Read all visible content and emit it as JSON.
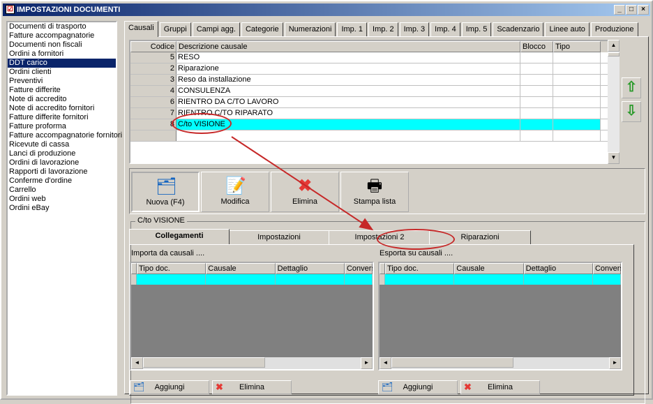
{
  "window": {
    "title": "IMPOSTAZIONI DOCUMENTI",
    "min_label": "_",
    "max_label": "□",
    "close_label": "×"
  },
  "doc_types": [
    "Documenti di trasporto",
    "Fatture accompagnatorie",
    "Documenti non fiscali",
    "Ordini a fornitori",
    "DDT carico",
    "Ordini clienti",
    "Preventivi",
    "Fatture differite",
    "Note di accredito",
    "Note di accredito fornitori",
    "Fatture differite fornitori",
    "Fatture proforma",
    "Fatture accompagnatorie fornitori",
    "Ricevute di cassa",
    "Lanci di produzione",
    "Ordini di lavorazione",
    "Rapporti di lavorazione",
    "Conferme d'ordine",
    "Carrello",
    "Ordini web",
    "Ordini eBay"
  ],
  "selected_doc_type": "DDT carico",
  "tabs": [
    "Causali",
    "Gruppi",
    "Campi agg.",
    "Categorie",
    "Numerazioni",
    "Imp. 1",
    "Imp. 2",
    "Imp. 3",
    "Imp. 4",
    "Imp. 5",
    "Scadenzario",
    "Linee auto",
    "Produzione"
  ],
  "active_tab": "Causali",
  "causali_grid": {
    "columns": [
      "Codice",
      "Descrizione causale",
      "Blocco",
      "Tipo"
    ],
    "rows": [
      {
        "codice": "5",
        "descrizione": "RESO",
        "blocco": "",
        "tipo": ""
      },
      {
        "codice": "2",
        "descrizione": "Riparazione",
        "blocco": "",
        "tipo": ""
      },
      {
        "codice": "3",
        "descrizione": "Reso da installazione",
        "blocco": "",
        "tipo": ""
      },
      {
        "codice": "4",
        "descrizione": "CONSULENZA",
        "blocco": "",
        "tipo": ""
      },
      {
        "codice": "6",
        "descrizione": "RIENTRO DA C/TO LAVORO",
        "blocco": "",
        "tipo": ""
      },
      {
        "codice": "7",
        "descrizione": "RIENTRO C/TO RIPARATO",
        "blocco": "",
        "tipo": ""
      },
      {
        "codice": "8",
        "descrizione": "C/to VISIONE",
        "blocco": "",
        "tipo": ""
      }
    ],
    "selected_row": 6
  },
  "toolbar": {
    "nuova": "Nuova (F4)",
    "modifica": "Modifica",
    "elimina": "Elimina",
    "stampa": "Stampa lista"
  },
  "detail": {
    "group_caption": "C/to VISIONE",
    "subtabs": [
      "Collegamenti",
      "Impostazioni",
      "Impostazioni 2",
      "Riparazioni"
    ],
    "active_subtab": "Collegamenti",
    "import": {
      "label": "Importa da causali ....",
      "columns": [
        "Tipo doc.",
        "Causale",
        "Dettaglio",
        "Conversi"
      ]
    },
    "export": {
      "label": "Esporta su causali ....",
      "columns": [
        "Tipo doc.",
        "Causale",
        "Dettaglio",
        "Conversi"
      ]
    },
    "add_label": "Aggiungi",
    "delete_label": "Elimina"
  },
  "colors": {
    "title_bar": "#0a246a",
    "selection_cyan": "#00ffff",
    "annotation_red": "#c62828"
  }
}
